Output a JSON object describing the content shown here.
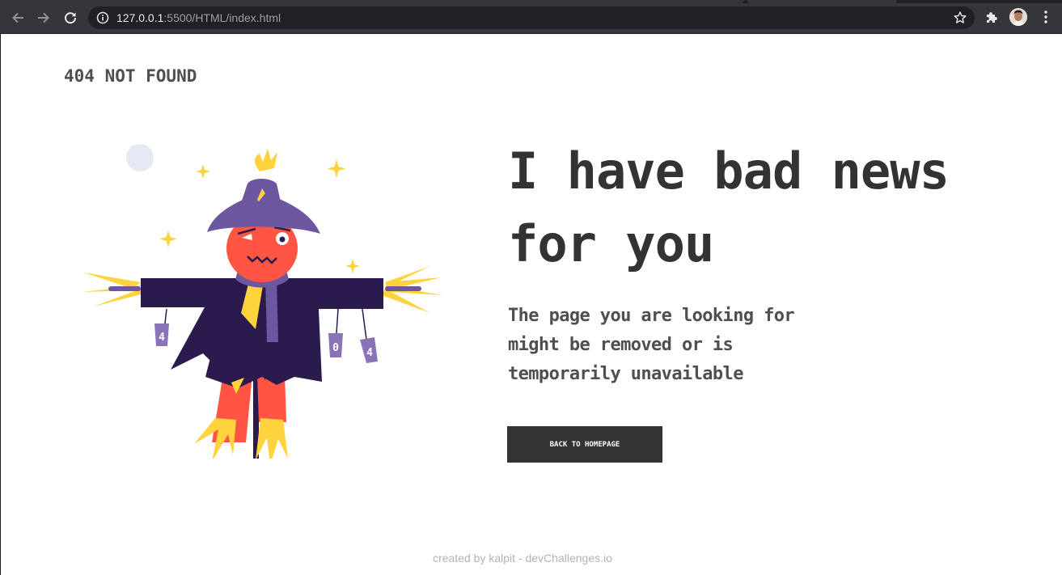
{
  "browser": {
    "url_host": "127.0.0.1",
    "url_rest": ":5500/HTML/index.html",
    "icons": {
      "back": "arrow-left-icon",
      "forward": "arrow-right-icon",
      "reload": "reload-icon",
      "site_info": "info-icon",
      "bookmark": "star-icon",
      "extensions": "puzzle-icon",
      "profile": "avatar",
      "menu": "kebab-menu-icon"
    }
  },
  "page": {
    "brand": "404 NOT FOUND",
    "headline": "I have bad news for you",
    "subtext": "The page you are looking for might be removed or is temporarily unavailable",
    "cta_label": "BACK TO HOMEPAGE",
    "footer": "created by kalpit - devChallenges.io",
    "illustration": {
      "name": "scarecrow",
      "can_labels": [
        "4",
        "0",
        "4"
      ]
    },
    "colors": {
      "text_dark": "#333333",
      "text_muted": "#4f4f4f",
      "button_bg": "#333333",
      "footer_text": "#b3b3b3",
      "scarecrow_purple": "#2b1b4c",
      "scarecrow_hat": "#6c57a0",
      "scarecrow_orange": "#ff5542",
      "straw_yellow": "#fed33b"
    }
  }
}
